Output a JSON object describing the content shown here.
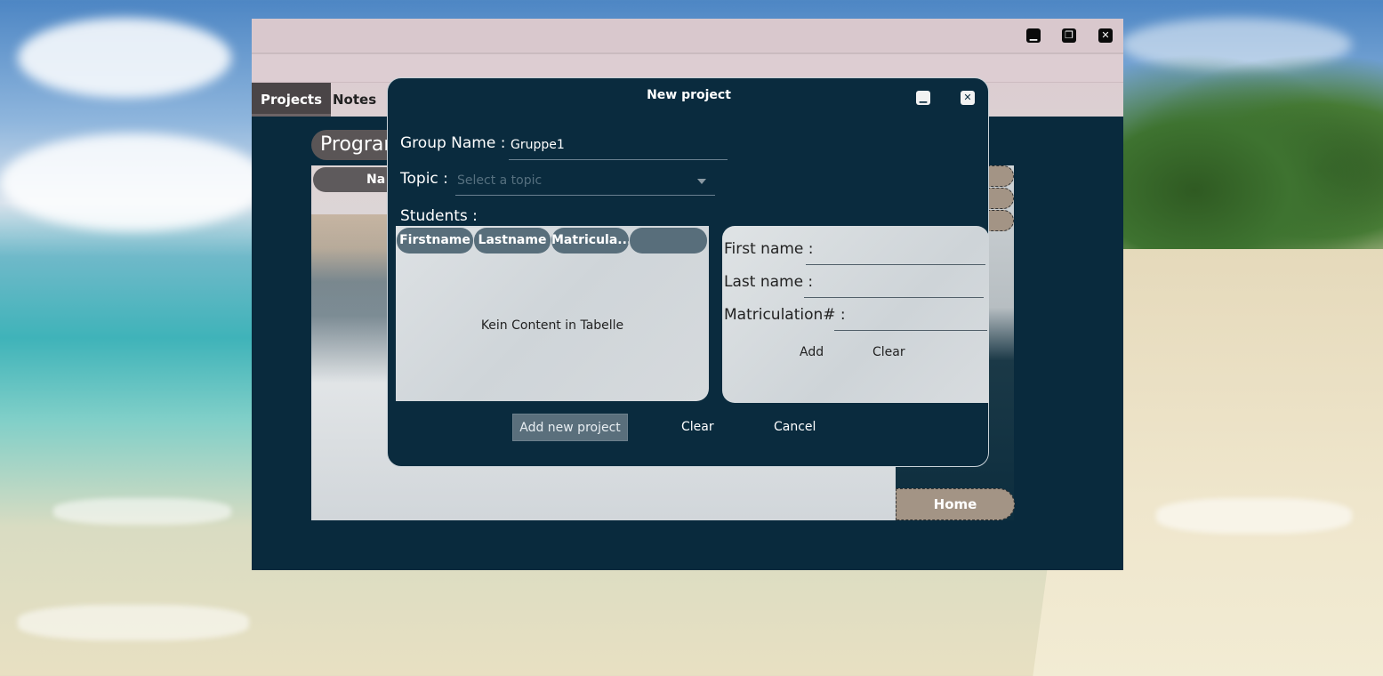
{
  "app": {
    "window_controls": {
      "minimize": "▁",
      "restore": "❐",
      "close": "✕"
    },
    "tabs": [
      {
        "label": "Projects",
        "active": true
      },
      {
        "label": "Notes",
        "active": false
      }
    ],
    "program_label": "Program",
    "name_header": "Na",
    "home_label": "Home"
  },
  "dialog": {
    "title": "New project",
    "controls": {
      "minimize": "▁",
      "close": "✕"
    },
    "group_name": {
      "label": "Group Name :",
      "value": "Gruppe1"
    },
    "topic": {
      "label": "Topic :",
      "placeholder": "Select a topic"
    },
    "students_label": "Students :",
    "table": {
      "columns": [
        "Firstname",
        "Lastname",
        "Matricula...",
        ""
      ],
      "empty_message": "Kein Content in Tabelle"
    },
    "student_form": {
      "first_name_label": "First name :",
      "last_name_label": "Last name :",
      "matriculation_label": "Matriculation# :",
      "add_label": "Add",
      "clear_label": "Clear"
    },
    "buttons": {
      "add_project": "Add new project",
      "clear": "Clear",
      "cancel": "Cancel"
    }
  },
  "colors": {
    "window_bg": "#092a3d",
    "titlebar": "#d9c8cd",
    "accent_button": "#5a6f7c",
    "home_button": "#a39485"
  }
}
